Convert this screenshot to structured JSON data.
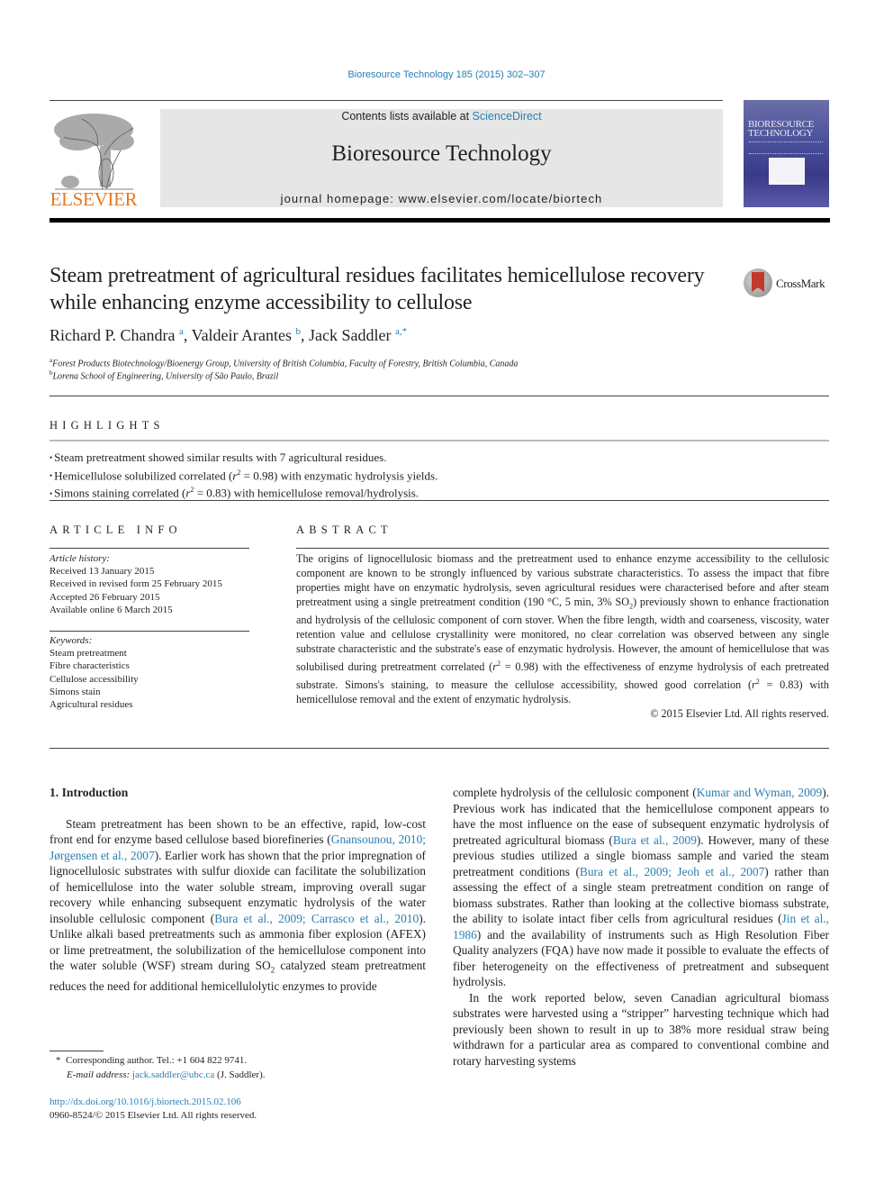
{
  "header": {
    "journal_citation": "Bioresource Technology 185 (2015) 302–307",
    "publisher_logo_text": "ELSEVIER",
    "contents_prefix": "Contents lists available at ",
    "contents_link": "ScienceDirect",
    "journal_title": "Bioresource Technology",
    "homepage_label": "journal homepage: www.elsevier.com/locate/biortech",
    "cover_title_line1": "BIORESOURCE",
    "cover_title_line2": "TECHNOLOGY"
  },
  "article": {
    "title": "Steam pretreatment of agricultural residues facilitates hemicellulose recovery while enhancing enzyme accessibility to cellulose",
    "crossmark_label": "CrossMark",
    "authors": [
      {
        "name": "Richard P. Chandra",
        "sup": "a"
      },
      {
        "name": "Valdeir Arantes",
        "sup": "b"
      },
      {
        "name": "Jack Saddler",
        "sup": "a,*"
      }
    ],
    "affiliations": [
      {
        "sup": "a",
        "text": "Forest Products Biotechnology/Bioenergy Group, University of British Columbia, Faculty of Forestry, British Columbia, Canada"
      },
      {
        "sup": "b",
        "text": "Lorena School of Engineering, University of São Paulo, Brazil"
      }
    ]
  },
  "highlights": {
    "heading": "HIGHLIGHTS",
    "items": [
      {
        "before": "Steam pretreatment showed similar results with 7 agricultural residues.",
        "after": ""
      },
      {
        "before": "Hemicellulose solubilized correlated (",
        "r": "r",
        "exp": "2",
        "value": " = 0.98",
        "after": ") with enzymatic hydrolysis yields."
      },
      {
        "before": "Simons staining correlated (",
        "r": "r",
        "exp": "2",
        "value": " = 0.83",
        "after": ") with hemicellulose removal/hydrolysis."
      }
    ]
  },
  "article_info": {
    "heading": "ARTICLE INFO",
    "history_label": "Article history:",
    "history": [
      "Received 13 January 2015",
      "Received in revised form 25 February 2015",
      "Accepted 26 February 2015",
      "Available online 6 March 2015"
    ],
    "keywords_label": "Keywords:",
    "keywords": [
      "Steam pretreatment",
      "Fibre characteristics",
      "Cellulose accessibility",
      "Simons stain",
      "Agricultural residues"
    ]
  },
  "abstract": {
    "heading": "ABSTRACT",
    "part1": "The origins of lignocellulosic biomass and the pretreatment used to enhance enzyme accessibility to the cellulosic component are known to be strongly influenced by various substrate characteristics. To assess the impact that fibre properties might have on enzymatic hydrolysis, seven agricultural residues were characterised before and after steam pretreatment using a single pretreatment condition (190 °C, 5 min, 3% SO",
    "sub1": "2",
    "part2": ") previously shown to enhance fractionation and hydrolysis of the cellulosic component of corn stover. When the fibre length, width and coarseness, viscosity, water retention value and cellulose crystallinity were monitored, no clear correlation was observed between any single substrate characteristic and the substrate's ease of enzymatic hydrolysis. However, the amount of hemicellulose that was solubilised during pretreatment correlated (",
    "r1": "r",
    "exp1": "2",
    "part3": " = 0.98) with the effectiveness of enzyme hydrolysis of each pretreated substrate. Simons's staining, to measure the cellulose accessibility, showed good correlation (",
    "r2": "r",
    "exp2": "2",
    "part4": " = 0.83) with hemicellulose removal and the extent of enzymatic hydrolysis.",
    "copyright": "© 2015 Elsevier Ltd. All rights reserved."
  },
  "body": {
    "section_heading": "1. Introduction",
    "left": {
      "t1": "Steam pretreatment has been shown to be an effective, rapid, low-cost front end for enzyme based cellulose based biorefineries (",
      "c1": "Gnansounou, 2010; Jørgensen et al., 2007",
      "t2": "). Earlier work has shown that the prior impregnation of lignocellulosic substrates with sulfur dioxide can facilitate the solubilization of hemicellulose into the water soluble stream, improving overall sugar recovery while enhancing subsequent enzymatic hydrolysis of the water insoluble cellulosic component (",
      "c2": "Bura et al., 2009; Carrasco et al., 2010",
      "t3": "). Unlike alkali based pretreatments such as ammonia fiber explosion (AFEX) or lime pretreatment, the solubilization of the hemicellulose component into the water soluble (WSF) stream during SO",
      "sub": "2",
      "t4": " catalyzed steam pretreatment reduces the need for additional hemicellulolytic enzymes to provide"
    },
    "right": {
      "t1": "complete hydrolysis of the cellulosic component (",
      "c1": "Kumar and Wyman, 2009",
      "t2": "). Previous work has indicated that the hemicellulose component appears to have the most influence on the ease of subsequent enzymatic hydrolysis of pretreated agricultural biomass (",
      "c2": "Bura et al., 2009",
      "t3": "). However, many of these previous studies utilized a single biomass sample and varied the steam pretreatment conditions (",
      "c3": "Bura et al., 2009; Jeoh et al., 2007",
      "t4": ") rather than assessing the effect of a single steam pretreatment condition on range of biomass substrates. Rather than looking at the collective biomass substrate, the ability to isolate intact fiber cells from agricultural residues (",
      "c4": "Jin et al., 1986",
      "t5": ") and the availability of instruments such as High Resolution Fiber Quality analyzers (FQA) have now made it possible to evaluate the effects of fiber heterogeneity on the effectiveness of pretreatment and subsequent hydrolysis.",
      "p2": "In the work reported below, seven Canadian agricultural biomass substrates were harvested using a “stripper” harvesting technique which had previously been shown to result in up to 38% more residual straw being withdrawn for a particular area as compared to conventional combine and rotary harvesting systems"
    }
  },
  "footnotes": {
    "corresponding_mark": "*",
    "corresponding": "Corresponding author. Tel.: +1 604 822 9741.",
    "email_label": "E-mail address: ",
    "email": "jack.saddler@ubc.ca",
    "email_suffix": " (J. Saddler).",
    "doi": "http://dx.doi.org/10.1016/j.biortech.2015.02.106",
    "issn_line": "0960-8524/© 2015 Elsevier Ltd. All rights reserved."
  }
}
